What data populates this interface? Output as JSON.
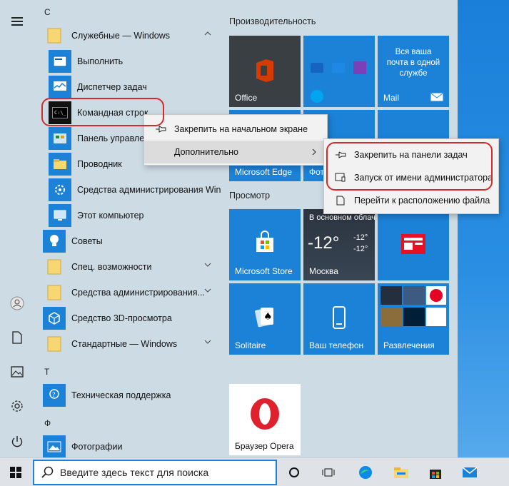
{
  "rail": {
    "menu_icon": "hamburger-icon",
    "items": [
      {
        "name": "user-icon"
      },
      {
        "name": "document-icon"
      },
      {
        "name": "pictures-icon"
      },
      {
        "name": "settings-icon"
      },
      {
        "name": "power-icon"
      }
    ]
  },
  "applist": {
    "letters": {
      "c": "С",
      "t": "Т",
      "f": "Ф"
    },
    "folder_system_tools": "Служебные — Windows",
    "run": "Выполнить",
    "task_manager": "Диспетчер задач",
    "cmd": "Командная строка",
    "control_panel": "Панель управления",
    "explorer": "Проводник",
    "admin_tools_sub": "Средства администрирования Windows",
    "this_pc": "Этот компьютер",
    "tips": "Советы",
    "accessibility": "Спец. возможности",
    "admin_tools": "Средства администрирования...",
    "viewer_3d": "Средство 3D-просмотра",
    "standard": "Стандартные — Windows",
    "support": "Техническая поддержка",
    "photos": "Фотографии"
  },
  "tiles": {
    "group_productivity": "Производительность",
    "group_browse": "Просмотр",
    "office": "Office",
    "mail_promo": "Вся ваша почта в одной службе",
    "mail": "Mail",
    "edge": "Microsoft Edge",
    "photos_partial": "Фото",
    "store": "Microsoft Store",
    "weather_header": "В основном облачно",
    "weather_temp": "-12°",
    "weather_temp_small": "-12°",
    "weather_temp_small2": "-12°",
    "weather_city": "Москва",
    "solitaire": "Solitaire",
    "phone": "Ваш телефон",
    "entertainment": "Развлечения",
    "opera": "Браузер Opera"
  },
  "context_menu_1": {
    "pin_start": "Закрепить на начальном экране",
    "more": "Дополнительно"
  },
  "context_menu_2": {
    "pin_taskbar": "Закрепить на панели задач",
    "run_as_admin": "Запуск от имени администратора",
    "open_location": "Перейти к расположению файла"
  },
  "taskbar": {
    "search_placeholder": "Введите здесь текст для поиска"
  },
  "colors": {
    "accent": "#1b82d8",
    "highlight_red": "#d32a2a",
    "office_tile": "#3a3f44",
    "opera_red": "#e0202c"
  }
}
